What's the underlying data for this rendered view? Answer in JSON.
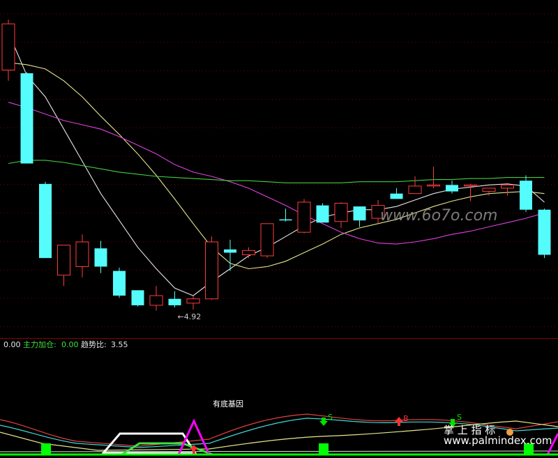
{
  "colors": {
    "background": "#000000",
    "up": "#ff3c3c",
    "down": "#54fcfc",
    "grid": "#7a0000",
    "ma5": "#e6e6e6",
    "ma10": "#e6e68c",
    "ma20": "#e040e0",
    "ma60": "#40d040",
    "green": "#00ff00",
    "magenta": "#ff00ff",
    "white": "#ffffff",
    "red": "#ff3030",
    "cyan": "#54fcfc"
  },
  "indicator_label": {
    "v0": "0.00",
    "name1": "主力加仓:",
    "v1": "0.00",
    "name2": "趋势比:",
    "v2": "3.55"
  },
  "annotations": {
    "low_price": "←4.92",
    "gene_label": "有底基因",
    "watermark_top": "www.6o7o.com",
    "watermark_bottom_title": "掌 上 指 标",
    "watermark_bottom_url": "www.palmindex.com",
    "signal_s": "S",
    "signal_b": "B"
  },
  "chart_data": {
    "type": "candlestick",
    "ylim": [
      4.7,
      7.75
    ],
    "candles": [
      {
        "o": 7.15,
        "h": 7.62,
        "l": 7.05,
        "c": 7.58
      },
      {
        "o": 7.12,
        "h": 7.13,
        "l": 6.28,
        "c": 6.28
      },
      {
        "o": 6.09,
        "h": 6.11,
        "l": 5.4,
        "c": 5.4
      },
      {
        "o": 5.24,
        "h": 5.36,
        "l": 5.14,
        "c": 5.52
      },
      {
        "o": 5.32,
        "h": 5.62,
        "l": 5.22,
        "c": 5.55
      },
      {
        "o": 5.49,
        "h": 5.56,
        "l": 5.26,
        "c": 5.32
      },
      {
        "o": 5.28,
        "h": 5.31,
        "l": 5.03,
        "c": 5.05
      },
      {
        "o": 5.1,
        "h": 5.1,
        "l": 4.95,
        "c": 4.96
      },
      {
        "o": 4.96,
        "h": 5.14,
        "l": 4.91,
        "c": 5.05
      },
      {
        "o": 5.02,
        "h": 5.09,
        "l": 4.94,
        "c": 4.96
      },
      {
        "o": 4.98,
        "h": 5.05,
        "l": 4.92,
        "c": 5.02
      },
      {
        "o": 5.02,
        "h": 5.6,
        "l": 5.01,
        "c": 5.55
      },
      {
        "o": 5.48,
        "h": 5.57,
        "l": 5.28,
        "c": 5.45
      },
      {
        "o": 5.43,
        "h": 5.5,
        "l": 5.4,
        "c": 5.47
      },
      {
        "o": 5.42,
        "h": 5.7,
        "l": 5.4,
        "c": 5.72
      },
      {
        "o": 5.76,
        "h": 5.86,
        "l": 5.74,
        "c": 5.75
      },
      {
        "o": 5.64,
        "h": 5.95,
        "l": 5.63,
        "c": 5.92
      },
      {
        "o": 5.89,
        "h": 5.91,
        "l": 5.77,
        "c": 5.73
      },
      {
        "o": 5.74,
        "h": 5.92,
        "l": 5.68,
        "c": 5.91
      },
      {
        "o": 5.88,
        "h": 5.88,
        "l": 5.69,
        "c": 5.75
      },
      {
        "o": 5.77,
        "h": 5.94,
        "l": 5.72,
        "c": 5.89
      },
      {
        "o": 6.0,
        "h": 6.05,
        "l": 5.96,
        "c": 5.95
      },
      {
        "o": 6.0,
        "h": 6.16,
        "l": 6.0,
        "c": 6.07
      },
      {
        "o": 6.08,
        "h": 6.25,
        "l": 6.05,
        "c": 6.08
      },
      {
        "o": 6.08,
        "h": 6.12,
        "l": 6.0,
        "c": 6.02
      },
      {
        "o": 6.07,
        "h": 6.09,
        "l": 5.93,
        "c": 6.08
      },
      {
        "o": 6.02,
        "h": 6.05,
        "l": 5.98,
        "c": 6.05
      },
      {
        "o": 6.05,
        "h": 6.08,
        "l": 5.98,
        "c": 6.08
      },
      {
        "o": 6.12,
        "h": 6.17,
        "l": 5.83,
        "c": 5.85
      },
      {
        "o": 5.85,
        "h": 5.86,
        "l": 5.4,
        "c": 5.43
      }
    ],
    "ma_lines": [
      {
        "name": "MA5",
        "values": [
          7.5,
          7.1,
          6.9,
          6.6,
          6.3,
          6.0,
          5.75,
          5.5,
          5.3,
          5.12,
          5.05,
          5.18,
          5.3,
          5.42,
          5.5,
          5.6,
          5.7,
          5.78,
          5.82,
          5.85,
          5.85,
          5.88,
          5.94,
          6.0,
          6.04,
          6.06,
          6.08,
          6.09,
          6.07,
          5.92
        ]
      },
      {
        "name": "MA10",
        "values": [
          7.22,
          7.2,
          7.16,
          7.05,
          6.9,
          6.72,
          6.55,
          6.37,
          6.17,
          5.95,
          5.72,
          5.5,
          5.35,
          5.3,
          5.32,
          5.37,
          5.45,
          5.53,
          5.62,
          5.68,
          5.72,
          5.76,
          5.82,
          5.88,
          5.93,
          5.97,
          6.0,
          6.01,
          6.02,
          6.0
        ]
      },
      {
        "name": "MA20",
        "values": [
          6.85,
          6.8,
          6.74,
          6.68,
          6.64,
          6.6,
          6.53,
          6.45,
          6.37,
          6.27,
          6.2,
          6.16,
          6.11,
          6.05,
          5.97,
          5.89,
          5.8,
          5.72,
          5.64,
          5.58,
          5.54,
          5.53,
          5.55,
          5.58,
          5.62,
          5.65,
          5.69,
          5.73,
          5.77,
          5.82
        ]
      },
      {
        "name": "MA60",
        "values": [
          6.28,
          6.31,
          6.31,
          6.29,
          6.26,
          6.23,
          6.2,
          6.18,
          6.16,
          6.15,
          6.14,
          6.13,
          6.12,
          6.12,
          6.11,
          6.1,
          6.1,
          6.1,
          6.1,
          6.11,
          6.11,
          6.11,
          6.12,
          6.13,
          6.13,
          6.14,
          6.14,
          6.15,
          6.15,
          6.15
        ]
      }
    ],
    "low_marker_index": 9
  }
}
